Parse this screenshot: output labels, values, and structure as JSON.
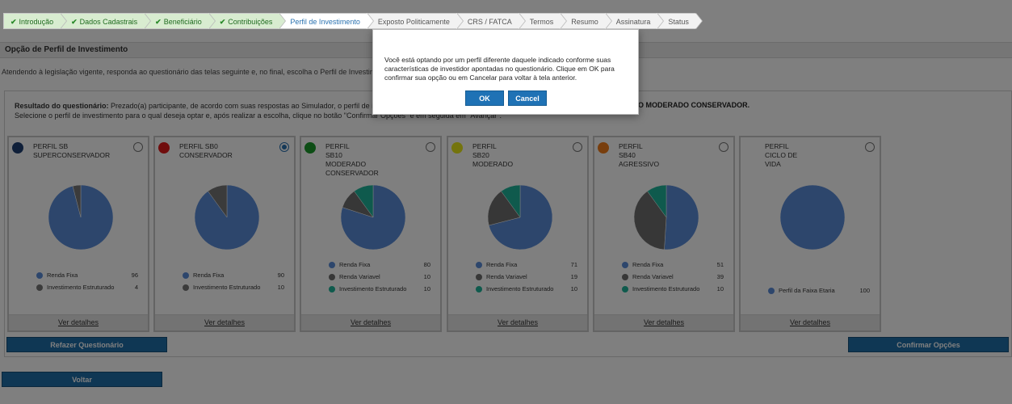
{
  "steps": [
    {
      "label": "Introdução",
      "state": "done"
    },
    {
      "label": "Dados Cadastrais",
      "state": "done"
    },
    {
      "label": "Beneficiário",
      "state": "done"
    },
    {
      "label": "Contribuições",
      "state": "done"
    },
    {
      "label": "Perfil de Investimento",
      "state": "active"
    },
    {
      "label": "Exposto Politicamente",
      "state": "todo"
    },
    {
      "label": "CRS / FATCA",
      "state": "todo"
    },
    {
      "label": "Termos",
      "state": "todo"
    },
    {
      "label": "Resumo",
      "state": "todo"
    },
    {
      "label": "Assinatura",
      "state": "todo"
    },
    {
      "label": "Status",
      "state": "todo"
    }
  ],
  "section_title": "Opção de Perfil de Investimento",
  "intro_text": "Atendendo à legislação vigente, responda ao questionário das telas seguinte e, no final, escolha o Perfil de Investimento que melhor se",
  "result": {
    "label": "Resultado do questionário:",
    "line1": " Prezado(a) participante, de acordo com suas respostas ao Simulador, o perfil de investimento recom",
    "line1_end": "O MODERADO CONSERVADOR.",
    "line2": "Selecione o perfil de investimento para o qual deseja optar e, após realizar a escolha, clique no botão \"Confirmar Opções\" e em seguida em \"Avançar\"."
  },
  "colors": {
    "renda_fixa": "#5b8dd9",
    "investimento_estruturado": "#777777",
    "renda_variavel": "#6e6e6e",
    "teal": "#1fb59a"
  },
  "profiles": [
    {
      "title": "PERFIL SB SUPERCONSERVADOR",
      "title_lines": [
        "PERFIL SB",
        "SUPERCONSERVADOR"
      ],
      "dot_color": "#1e3f73",
      "selected": false,
      "legend": [
        {
          "label": "Renda Fixa",
          "value": "96",
          "color": "#5b8dd9"
        },
        {
          "label": "Investimento Estruturado",
          "value": "4",
          "color": "#777777"
        }
      ],
      "details": "Ver detalhes"
    },
    {
      "title": "PERFIL SB0 CONSERVADOR",
      "title_lines": [
        "PERFIL SB0",
        "CONSERVADOR"
      ],
      "dot_color": "#e01b1b",
      "selected": true,
      "legend": [
        {
          "label": "Renda Fixa",
          "value": "90",
          "color": "#5b8dd9"
        },
        {
          "label": "Investimento Estruturado",
          "value": "10",
          "color": "#777777"
        }
      ],
      "details": "Ver detalhes"
    },
    {
      "title": "PERFIL SB10 MODERADO CONSERVADOR",
      "title_lines": [
        "PERFIL",
        "SB10",
        "MODERADO",
        "CONSERVADOR"
      ],
      "dot_color": "#1a9a2a",
      "selected": false,
      "legend": [
        {
          "label": "Renda Fixa",
          "value": "80",
          "color": "#5b8dd9"
        },
        {
          "label": "Renda Variavel",
          "value": "10",
          "color": "#6e6e6e"
        },
        {
          "label": "Investimento Estruturado",
          "value": "10",
          "color": "#1fb59a"
        }
      ],
      "details": "Ver detalhes"
    },
    {
      "title": "PERFIL SB20 MODERADO",
      "title_lines": [
        "PERFIL",
        "SB20",
        "MODERADO"
      ],
      "dot_color": "#e8e81a",
      "selected": false,
      "legend": [
        {
          "label": "Renda Fixa",
          "value": "71",
          "color": "#5b8dd9"
        },
        {
          "label": "Renda Variavel",
          "value": "19",
          "color": "#6e6e6e"
        },
        {
          "label": "Investimento Estruturado",
          "value": "10",
          "color": "#1fb59a"
        }
      ],
      "details": "Ver detalhes"
    },
    {
      "title": "PERFIL SB40 AGRESSIVO",
      "title_lines": [
        "PERFIL",
        "SB40",
        "AGRESSIVO"
      ],
      "dot_color": "#f07d1a",
      "selected": false,
      "legend": [
        {
          "label": "Renda Fixa",
          "value": "51",
          "color": "#5b8dd9"
        },
        {
          "label": "Renda Variavel",
          "value": "39",
          "color": "#6e6e6e"
        },
        {
          "label": "Investimento Estruturado",
          "value": "10",
          "color": "#1fb59a"
        }
      ],
      "details": "Ver detalhes"
    },
    {
      "title": "PERFIL CICLO DE VIDA",
      "title_lines": [
        "PERFIL",
        "CICLO DE",
        "VIDA"
      ],
      "dot_color": "",
      "selected": false,
      "legend": [
        {
          "label": "Perfil da Faixa Etaria",
          "value": "100",
          "color": "#5b8dd9"
        }
      ],
      "details": "Ver detalhes"
    }
  ],
  "buttons": {
    "refazer": "Refazer Questionário",
    "confirmar": "Confirmar Opções",
    "voltar": "Voltar"
  },
  "modal": {
    "message": "Você está optando por um perfil diferente daquele indicado conforme suas características de investidor apontadas no questionário. Clique em OK para confirmar sua opção ou em Cancelar para voltar à tela anterior.",
    "ok": "OK",
    "cancel": "Cancel"
  }
}
